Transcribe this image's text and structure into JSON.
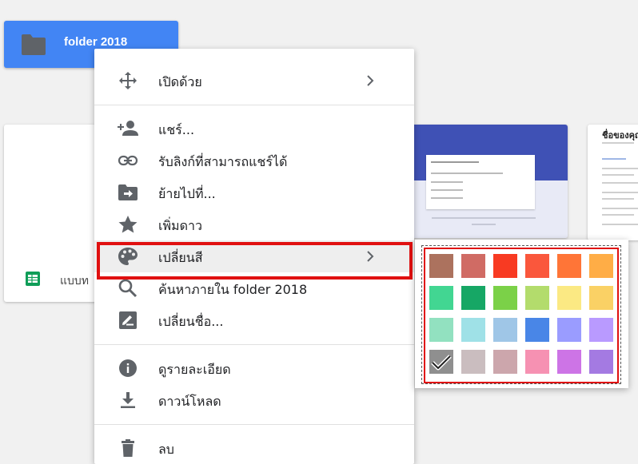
{
  "folder": {
    "name": "folder 2018",
    "color": "#4285f4"
  },
  "files": [
    {
      "name": "แบบท"
    }
  ],
  "menu": {
    "items": [
      {
        "id": "open-with",
        "label": "เปิดด้วย",
        "icon": "move-icon",
        "submenu": true
      },
      {
        "id": "share",
        "label": "แชร์...",
        "icon": "person-add-icon"
      },
      {
        "id": "get-link",
        "label": "รับลิงก์ที่สามารถแชร์ได้",
        "icon": "link-icon"
      },
      {
        "id": "move-to",
        "label": "ย้ายไปที่...",
        "icon": "folder-move-icon"
      },
      {
        "id": "add-star",
        "label": "เพิ่มดาว",
        "icon": "star-icon"
      },
      {
        "id": "change-color",
        "label": "เปลี่ยนสี",
        "icon": "palette-icon",
        "submenu": true,
        "highlighted": true
      },
      {
        "id": "search-in",
        "label": "ค้นหาภายใน folder 2018",
        "icon": "search-icon"
      },
      {
        "id": "rename",
        "label": "เปลี่ยนชื่อ...",
        "icon": "rename-icon"
      },
      {
        "id": "details",
        "label": "ดูรายละเอียด",
        "icon": "info-icon"
      },
      {
        "id": "download",
        "label": "ดาวน์โหลด",
        "icon": "download-icon"
      },
      {
        "id": "remove",
        "label": "ลบ",
        "icon": "trash-icon"
      }
    ]
  },
  "palette": {
    "selected": "#8f8f8f",
    "colors": [
      [
        "#ac725e",
        "#d06b64",
        "#f83a22",
        "#fa573c",
        "#ff7537",
        "#ffad46"
      ],
      [
        "#42d692",
        "#16a765",
        "#7bd148",
        "#b3dc6c",
        "#fbe983",
        "#fad165"
      ],
      [
        "#92e1c0",
        "#9fe1e7",
        "#9fc6e7",
        "#4986e7",
        "#9a9cff",
        "#b99aff"
      ],
      [
        "#8f8f8f",
        "#cabdbf",
        "#cca6ac",
        "#f691b2",
        "#cd74e6",
        "#a47ae2"
      ]
    ]
  },
  "doc_preview": {
    "title": "ชื่อของคุณ"
  },
  "form_preview": {
    "title": "แบบทดสอบ"
  }
}
